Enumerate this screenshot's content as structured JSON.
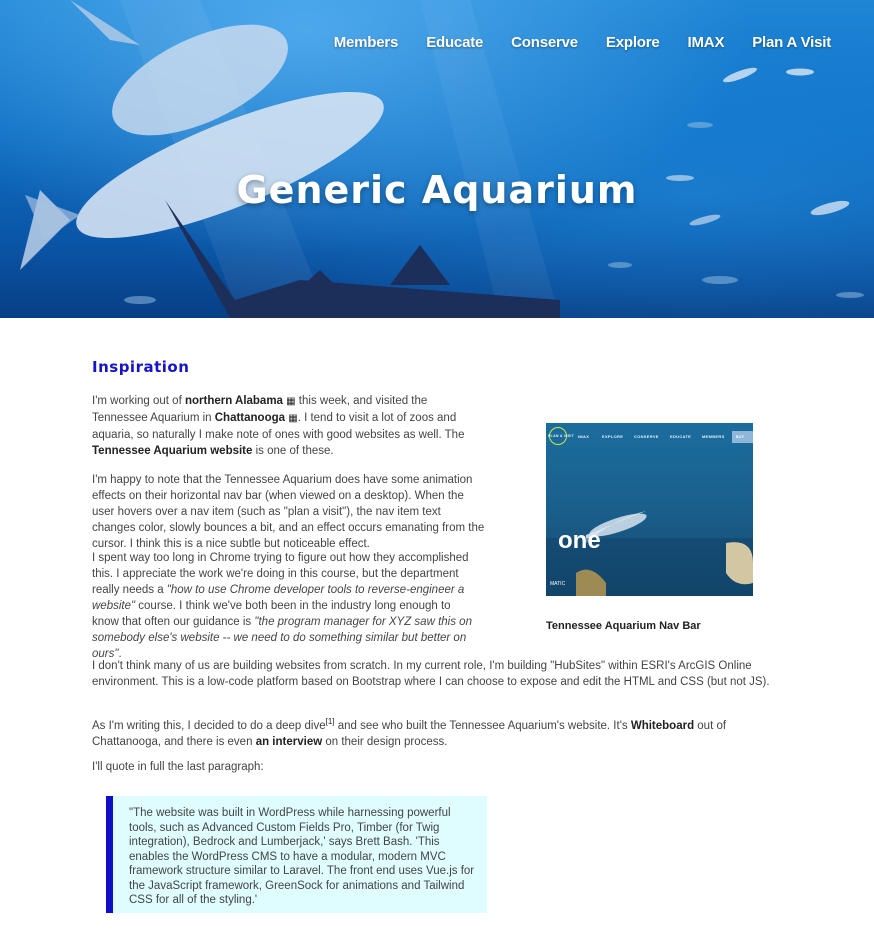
{
  "nav": [
    "Members",
    "Educate",
    "Conserve",
    "Explore",
    "IMAX",
    "Plan A Visit"
  ],
  "hero_title": "Generic Aquarium",
  "section_title": "Inspiration",
  "p1": {
    "t1": "I'm working out of ",
    "b1": "northern Alabama",
    "t2": " this week, and visited the Tennessee Aquarium in ",
    "b2": "Chattanooga",
    "t3": ". I tend to visit a lot of zoos and aquaria, so naturally I make note of ones with good websites as well. The ",
    "b3": "Tennessee Aquarium website",
    "t4": " is one of these."
  },
  "p2": "I'm happy to note that the Tennessee Aquarium does have some animation effects on their horizontal nav bar (when viewed on a desktop). When the user hovers over a nav item (such as \"plan a visit\"), the nav item text changes color, slowly bounces a bit, and an effect occurs emanating from the cursor. I think this is a nice subtle but noticeable effect.",
  "p3": {
    "t1": "I spent way too long in Chrome trying to figure out how they accomplished this. I appreciate the work we're doing in this course, but the department really needs a ",
    "i1": "\"how to use Chrome developer tools to reverse-engineer a website\"",
    "t2": " course. I think we've both been in the industry long enough to know that often our guidance is ",
    "i2": "\"the program manager for XYZ saw this on somebody else's website -- we need to do something similar but better on ours\"",
    "t3": "."
  },
  "figure": {
    "nav": [
      "IMAX",
      "EXPLORE",
      "CONSERVE",
      "EDUCATE",
      "MEMBERS"
    ],
    "button": "BUY",
    "logo": "PLAN A VISIT",
    "big_text": "one",
    "badge": "MATIC",
    "caption": "Tennessee Aquarium Nav Bar"
  },
  "p4": "I don't think many of us are building websites from scratch. In my current role, I'm building \"HubSites\" within ESRI's ArcGIS Online environment. This is a low-code platform based on Bootstrap where I can choose to expose and edit the HTML and CSS (but not JS).",
  "p5": {
    "t1": "As I'm writing this, I decided to do a deep dive",
    "sup": "[1]",
    "t2": " and see who built the Tennessee Aquarium's website. It's ",
    "b1": "Whiteboard",
    "t3": " out of Chattanooga, and there is even ",
    "b2": "an interview",
    "t4": " on their design process."
  },
  "p6": "I'll quote in full the last paragraph:",
  "quote": "\"The website was built in WordPress while harnessing powerful tools, such as Advanced Custom Fields Pro, Timber (for Twig integration), Bedrock and Lumberjack,' says Brett Bash. 'This enables the WordPress CMS to have a modular, modern MVC framework structure similar to Laravel. The front end uses Vue.js for the JavaScript framework, GreenSock for animations and Tailwind CSS for all of the styling.'",
  "icons": [
    "map-icon"
  ]
}
